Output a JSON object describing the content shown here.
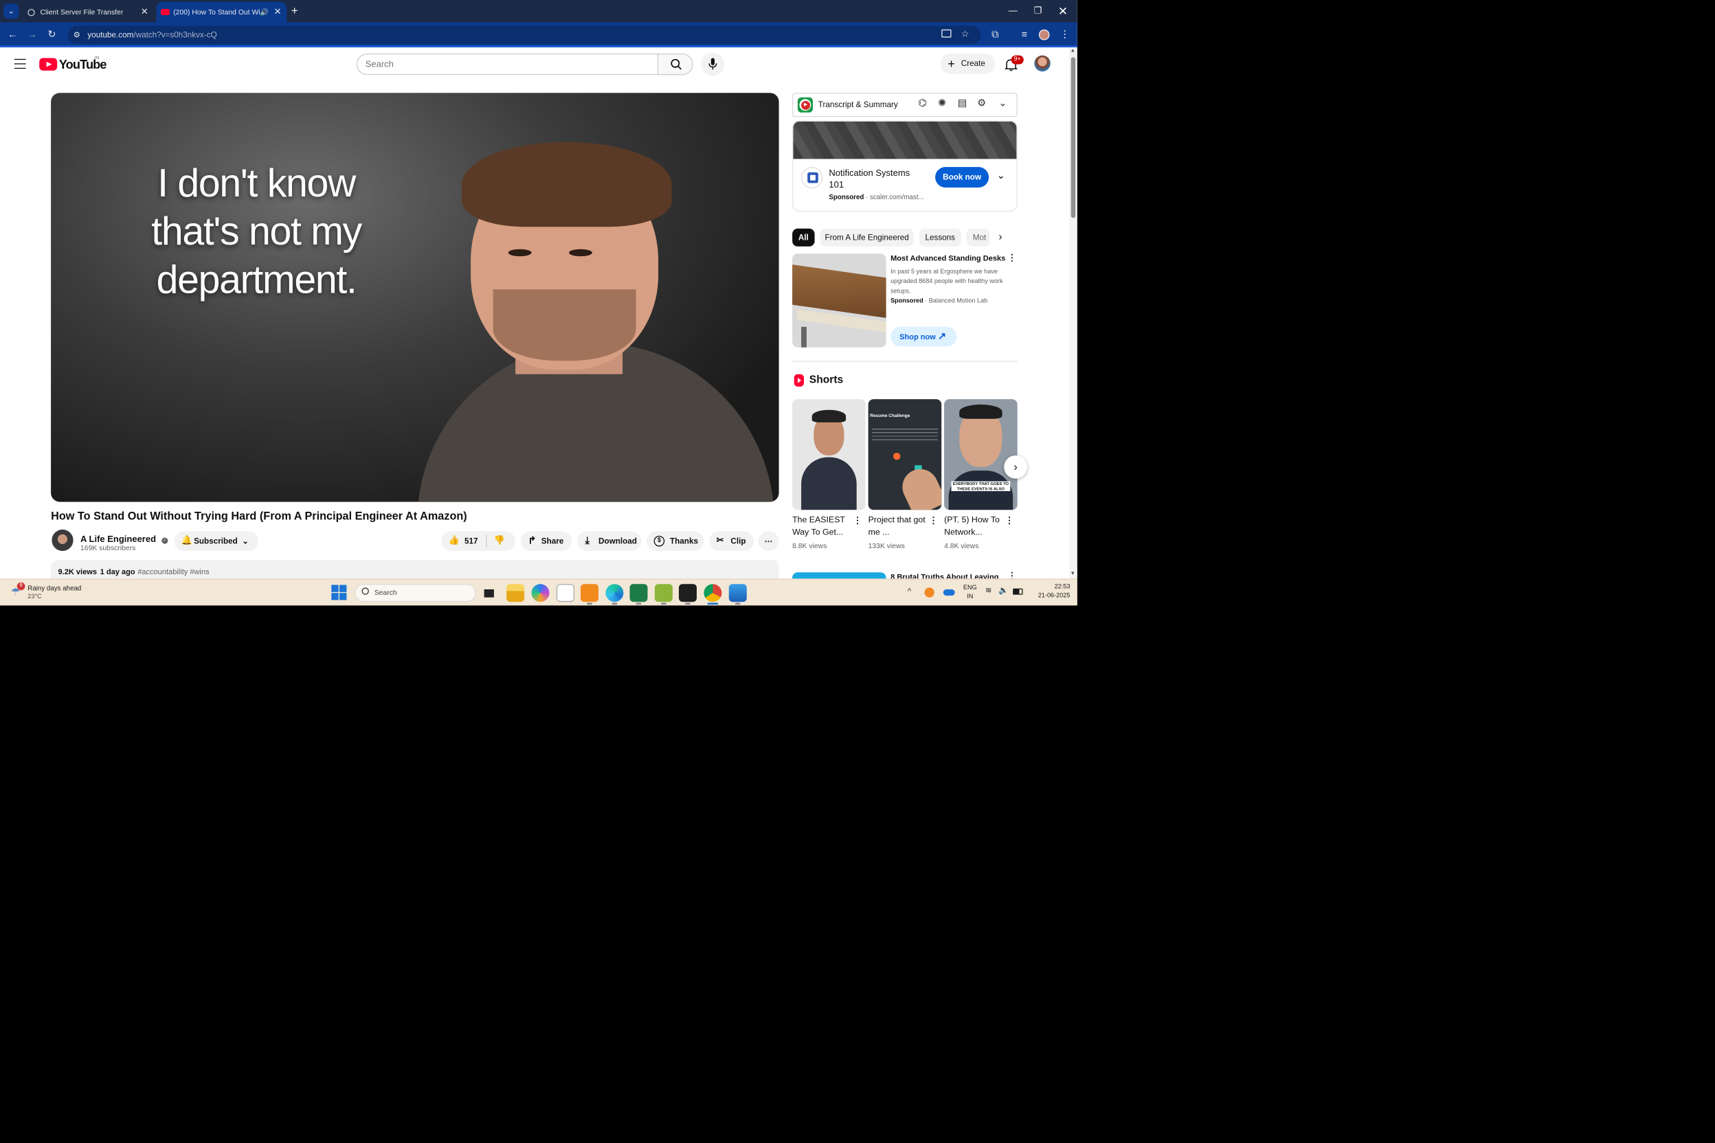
{
  "browser": {
    "tabs": [
      {
        "title": "Client Server File Transfer"
      },
      {
        "title": "(200) How To Stand Out Wi"
      }
    ],
    "url_host": "youtube.com",
    "url_path": "/watch?v=s0h3nkvx-cQ"
  },
  "youtube": {
    "logo_text": "YouTube",
    "country_code": "IN",
    "search_placeholder": "Search",
    "create_label": "Create",
    "notification_count": "9+",
    "thumbnail_text": "I don't know that's not my department.",
    "video_title": "How To Stand Out Without Trying Hard (From A Principal Engineer At Amazon)",
    "channel_name": "A Life Engineered",
    "subscribers": "169K subscribers",
    "subscribed_label": "Subscribed",
    "like_count": "517",
    "share_label": "Share",
    "download_label": "Download",
    "thanks_label": "Thanks",
    "clip_label": "Clip",
    "views": "9.2K views",
    "posted": "1 day ago",
    "hashtags": "#accountability #wins"
  },
  "sidebar": {
    "extension_title": "Transcript & Summary",
    "ad1": {
      "title": "Notification Systems 101",
      "sponsored": "Sponsored",
      "source": "scaler.com/mast...",
      "cta": "Book now"
    },
    "chips": [
      "All",
      "From A Life Engineered",
      "Lessons",
      "Mot"
    ],
    "ad2": {
      "title": "Most Advanced Standing Desks",
      "desc": "In past 5 years at Ergosphere we have upgraded 8684 people with healthy work setups.",
      "sponsored": "Sponsored",
      "source": "Balanced Motion Lab",
      "cta": "Shop now"
    },
    "shorts_heading": "Shorts",
    "shorts": [
      {
        "title": "The EASIEST Way To Get...",
        "views": "8.8K views",
        "thumb_caption": ""
      },
      {
        "title": "Project that got me ...",
        "views": "133K views",
        "thumb_caption": "Resume Challenge"
      },
      {
        "title": "(PT. 5) How To Network...",
        "views": "4.8K views",
        "thumb_caption": "EVERYBODY THAT GOES TO THESE EVENTS IS ALSO"
      }
    ],
    "next_video_title": "8 Brutal Truths About Leaving"
  },
  "taskbar": {
    "weather_title": "Rainy days ahead",
    "weather_temp": "23°C",
    "weather_badge": "9",
    "search_placeholder": "Search",
    "lang_line1": "ENG",
    "lang_line2": "IN",
    "time": "22:53",
    "date": "21-06-2025"
  },
  "colors": {
    "browser_tabstrip": "#1b2a46",
    "browser_toolbar": "#0b3a8d",
    "youtube_red": "#ff0033",
    "cta_blue": "#065fd4",
    "taskbar": "#f3e7d6"
  }
}
